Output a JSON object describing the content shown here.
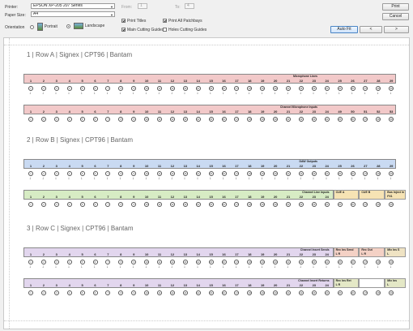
{
  "toolbar": {
    "printer_label": "Printer:",
    "printer_value": "EPSON XP-205 207 Series",
    "paper_label": "Paper Size:",
    "paper_value": "A4",
    "orientation_label": "Orientation",
    "portrait_label": "Portrait",
    "landscape_label": "Landscape",
    "from_label": "From:",
    "from_value": "1",
    "to_label": "To:",
    "to_value": "4",
    "print_titles_label": "Print Titles",
    "print_all_label": "Print All Patchbays",
    "main_guides_label": "Main Cutting Guides",
    "holes_guides_label": "Holes Cutting Guides",
    "print_button": "Print",
    "cancel_button": "Cancel",
    "autofit_button": "Auto Fit",
    "prev_button": "<",
    "next_button": ">"
  },
  "sections": [
    {
      "title": "1 | Row A | Signex | CPT96 | Bantam",
      "top_bar": {
        "label": "Microphone Lines",
        "color": "#f2c9c9"
      },
      "top_numbers": [
        "1",
        "2",
        "3",
        "4",
        "5",
        "6",
        "7",
        "8",
        "9",
        "10",
        "11",
        "12",
        "13",
        "14",
        "15",
        "16",
        "17",
        "18",
        "19",
        "20",
        "21",
        "22",
        "23",
        "24",
        "25",
        "26",
        "27",
        "28",
        "29"
      ],
      "top_circles": [
        "1",
        "2",
        "3",
        "4",
        "5",
        "6",
        "7",
        "8",
        "9",
        "10",
        "11",
        "12",
        "13",
        "14",
        "15",
        "16",
        "17",
        "18",
        "19",
        "20",
        "21",
        "22",
        "23",
        "24",
        "25",
        "26",
        "27",
        "28",
        "29"
      ],
      "bottom_bar": {
        "label": "Channel Microphone Inputs",
        "color": "#f2c9c9"
      },
      "bottom_numbers": [
        "1",
        "2",
        "3",
        "4",
        "5",
        "6",
        "7",
        "8",
        "9",
        "10",
        "11",
        "12",
        "13",
        "14",
        "15",
        "16",
        "17",
        "18",
        "19",
        "20",
        "21",
        "22",
        "23",
        "24",
        "49",
        "50",
        "51",
        "52",
        "53"
      ],
      "bottom_circles": [
        "1",
        "2",
        "3",
        "4",
        "5",
        "6",
        "7",
        "8",
        "9",
        "10",
        "11",
        "12",
        "13",
        "14",
        "15",
        "16",
        "17",
        "18",
        "19",
        "20",
        "21",
        "22",
        "23",
        "24",
        "25",
        "26",
        "27",
        "28",
        "29"
      ]
    },
    {
      "title": "2 | Row B | Signex | CPT96 | Bantam",
      "top_bar": {
        "label": "DAW Outputs",
        "color": "#c9daf2"
      },
      "top_numbers": [
        "1",
        "2",
        "3",
        "4",
        "5",
        "6",
        "7",
        "8",
        "9",
        "10",
        "11",
        "12",
        "13",
        "14",
        "15",
        "16",
        "17",
        "18",
        "19",
        "20",
        "21",
        "22",
        "23",
        "24",
        "25",
        "26",
        "27",
        "28",
        "29"
      ],
      "top_circles": [
        "1",
        "2",
        "3",
        "4",
        "5",
        "6",
        "7",
        "8",
        "9",
        "10",
        "11",
        "12",
        "13",
        "14",
        "15",
        "16",
        "17",
        "18",
        "19",
        "20",
        "21",
        "22",
        "23",
        "24",
        "25",
        "26",
        "27",
        "28",
        "29"
      ],
      "bottom_bar": {
        "label": "Channel Line Inputs",
        "color": "#d7ecc4"
      },
      "bottom_numbers": [
        "1",
        "2",
        "3",
        "4",
        "5",
        "6",
        "7",
        "8",
        "9",
        "10",
        "11",
        "12",
        "13",
        "14",
        "15",
        "16",
        "17",
        "18",
        "19",
        "20",
        "21",
        "22",
        "23",
        "24"
      ],
      "bottom_extra": [
        {
          "label": "CUE A",
          "color": "#f6e3b4"
        },
        {
          "label": "CUE B",
          "color": "#f6e3b4"
        },
        {
          "label": "Bus Inject in",
          "sub": "FX1",
          "color": "#f6e3b4"
        }
      ],
      "bottom_circles": [
        "1",
        "2",
        "3",
        "4",
        "5",
        "6",
        "7",
        "8",
        "9",
        "10",
        "11",
        "12",
        "13",
        "14",
        "15",
        "16",
        "17",
        "18",
        "19",
        "20",
        "21",
        "22",
        "23",
        "24",
        "25",
        "26",
        "27",
        "28",
        "29"
      ]
    },
    {
      "title": "3 | Row C | Signex | CPT96 | Bantam",
      "top_bar": {
        "label": "Channel Insert Sends",
        "color": "#e2d6ee"
      },
      "top_numbers": [
        "1",
        "2",
        "3",
        "4",
        "5",
        "6",
        "7",
        "8",
        "9",
        "10",
        "11",
        "12",
        "13",
        "14",
        "15",
        "16",
        "17",
        "18",
        "19",
        "20",
        "21",
        "22",
        "23",
        "24"
      ],
      "top_extra": [
        {
          "label": "Rec Ins Send",
          "sub": "L      R",
          "color": "#f4d1c5"
        },
        {
          "label": "Rec Out",
          "sub": "L      R",
          "color": "#f4d1c5"
        },
        {
          "label": "Mix Ins S",
          "sub": "L",
          "color": "#efe3c3"
        }
      ],
      "top_circles": [
        "1",
        "2",
        "3",
        "4",
        "5",
        "6",
        "7",
        "8",
        "9",
        "10",
        "11",
        "12",
        "13",
        "14",
        "15",
        "16",
        "17",
        "18",
        "19",
        "20",
        "21",
        "22",
        "23",
        "24",
        "25",
        "26",
        "27",
        "28",
        "29"
      ],
      "bottom_bar": {
        "label": "Channel Insert Returns",
        "color": "#e2d6ee"
      },
      "bottom_numbers": [
        "1",
        "2",
        "3",
        "4",
        "5",
        "6",
        "7",
        "8",
        "9",
        "10",
        "11",
        "12",
        "13",
        "14",
        "15",
        "16",
        "17",
        "18",
        "19",
        "20",
        "21",
        "22",
        "23",
        "24"
      ],
      "bottom_extra": [
        {
          "label": "Rec Ins Ret",
          "sub": "L      R",
          "color": "#e4e8c6"
        },
        {
          "label": "",
          "sub": "",
          "color": "#ffffff"
        },
        {
          "label": "Mix Ins",
          "sub": "L",
          "color": "#e4e8c6"
        }
      ],
      "bottom_circles": [
        "1",
        "2",
        "3",
        "4",
        "5",
        "6",
        "7",
        "8",
        "9",
        "10",
        "11",
        "12",
        "13",
        "14",
        "15",
        "16",
        "17",
        "18",
        "19",
        "20",
        "21",
        "22",
        "23",
        "24",
        "25",
        "26",
        "27",
        "28",
        "29"
      ]
    }
  ]
}
